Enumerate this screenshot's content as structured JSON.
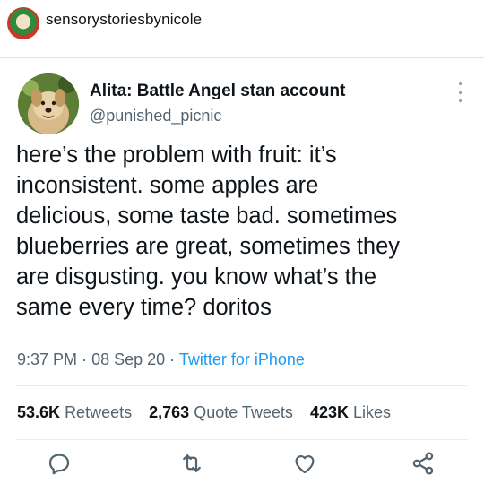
{
  "instagram": {
    "username": "sensorystoriesbynicole"
  },
  "tweet": {
    "author_name": "Alita: Battle Angel stan account",
    "author_handle": "@punished_picnic",
    "text_lines": [
      "here’s the problem with fruit: it’s",
      "inconsistent. some apples are",
      "delicious, some taste bad. sometimes",
      "blueberries are great, sometimes they",
      "are disgusting. you know what’s the",
      "same every time? doritos"
    ],
    "time": "9:37 PM",
    "separator": "·",
    "date": "08 Sep 20",
    "source": "Twitter for iPhone",
    "stats": {
      "retweets_count": "53.6K",
      "retweets_label": "Retweets",
      "quotes_count": "2,763",
      "quotes_label": "Quote Tweets",
      "likes_count": "423K",
      "likes_label": "Likes"
    }
  },
  "icons": [
    "reply-icon",
    "retweet-icon",
    "like-icon",
    "share-icon",
    "more-icon"
  ],
  "colors": {
    "text": "#0f1419",
    "secondary": "#536471",
    "link": "#1d9bf0"
  }
}
